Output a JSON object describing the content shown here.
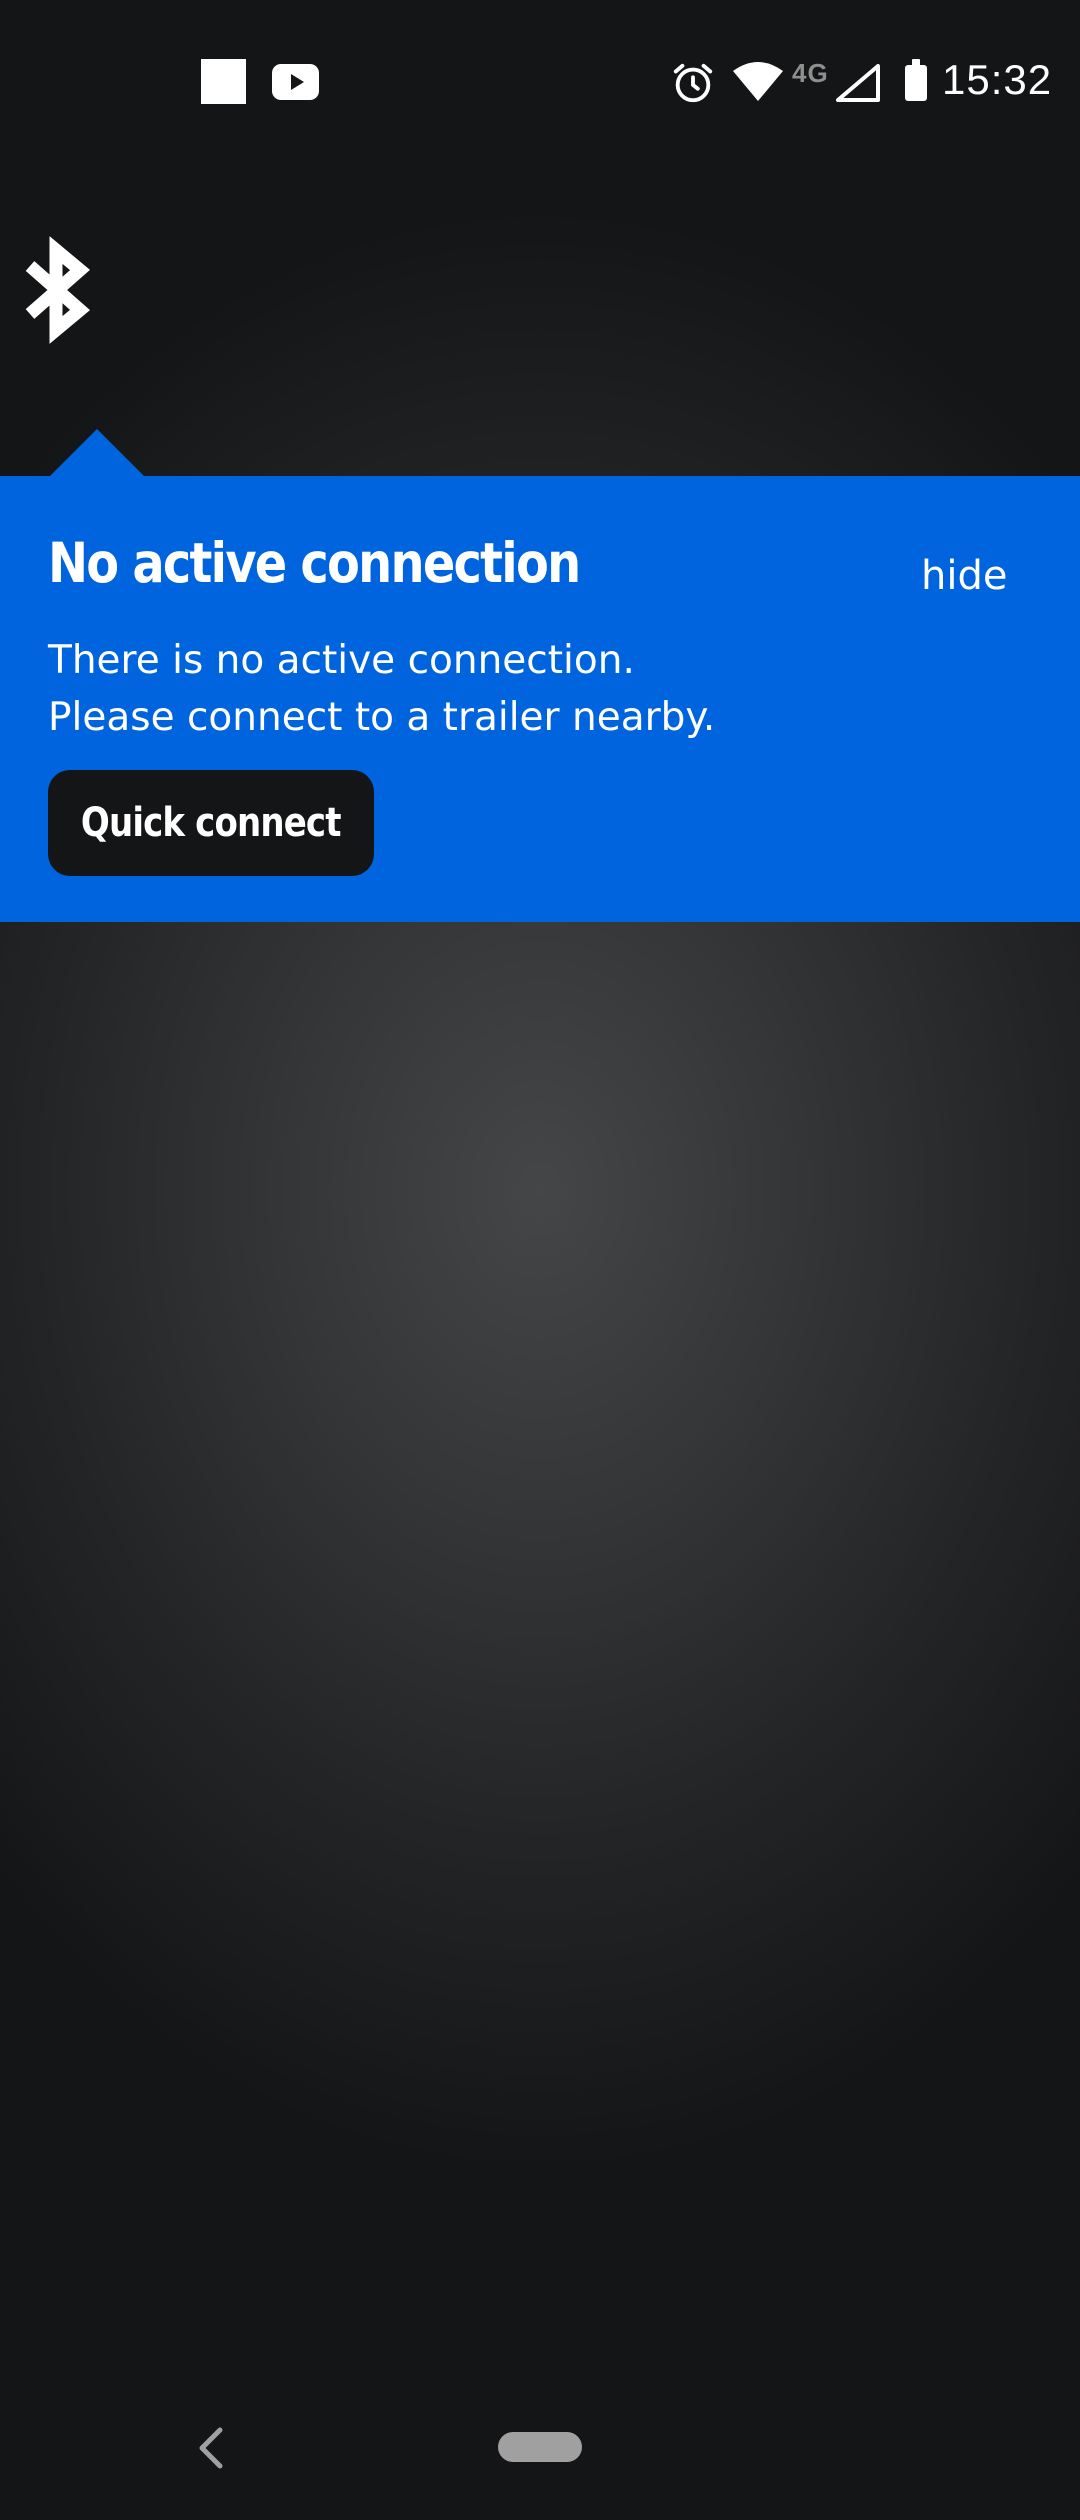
{
  "status_bar": {
    "time": "15:32",
    "network": "4G",
    "icons": [
      "stop-icon",
      "youtube-icon",
      "alarm-icon",
      "wifi-icon",
      "cell-signal-icon",
      "battery-icon"
    ]
  },
  "header": {
    "icon": "bluetooth-icon"
  },
  "popover": {
    "title": "No active connection",
    "hide_label": "hide",
    "lines": [
      "There is no active connection.",
      "Please connect to a trailer nearby."
    ],
    "button_label": "Quick connect",
    "background_color": "#0064de",
    "button_color": "#141517"
  },
  "nav_bar": {
    "icons": [
      "back-icon",
      "home-pill"
    ]
  },
  "colors": {
    "background": "#141517",
    "center_glow": "#454647",
    "text": "#ffffff"
  }
}
